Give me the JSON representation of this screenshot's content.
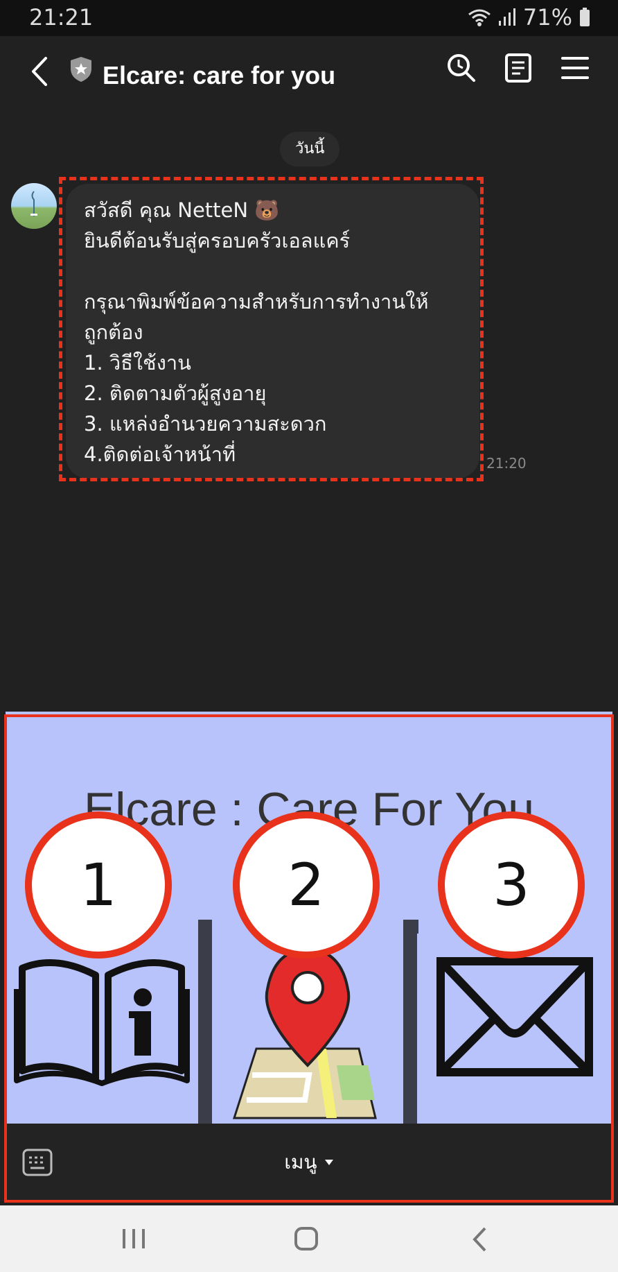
{
  "status_bar": {
    "time": "21:21",
    "battery": "71%"
  },
  "header": {
    "title": "Elcare: care for you"
  },
  "chat": {
    "date_chip": "วันนี้",
    "message": {
      "text": "สวัสดี คุณ NetteN 🐻\nยินดีต้อนรับสู่ครอบครัวเอลแคร์\n\nกรุณาพิมพ์ข้อความสำหรับการทำงานให้\nถูกต้อง\n1. วิธีใช้งาน\n2. ติดตามตัวผู้สูงอายุ\n3. แหล่งอำนวยความสะดวก\n4.ติดต่อเจ้าหน้าที่",
      "time": "21:20"
    }
  },
  "rich_menu": {
    "title": "Elcare : Care For You",
    "badges": [
      "1",
      "2",
      "3"
    ],
    "items": [
      {
        "icon": "book-info-icon"
      },
      {
        "icon": "map-pin-icon"
      },
      {
        "icon": "mail-icon"
      }
    ]
  },
  "bottom_bar": {
    "menu_label": "เมนู"
  },
  "colors": {
    "annotation_red": "#e8321b",
    "menu_bg": "#b9c3fb",
    "pin_red": "#e32b2b"
  }
}
